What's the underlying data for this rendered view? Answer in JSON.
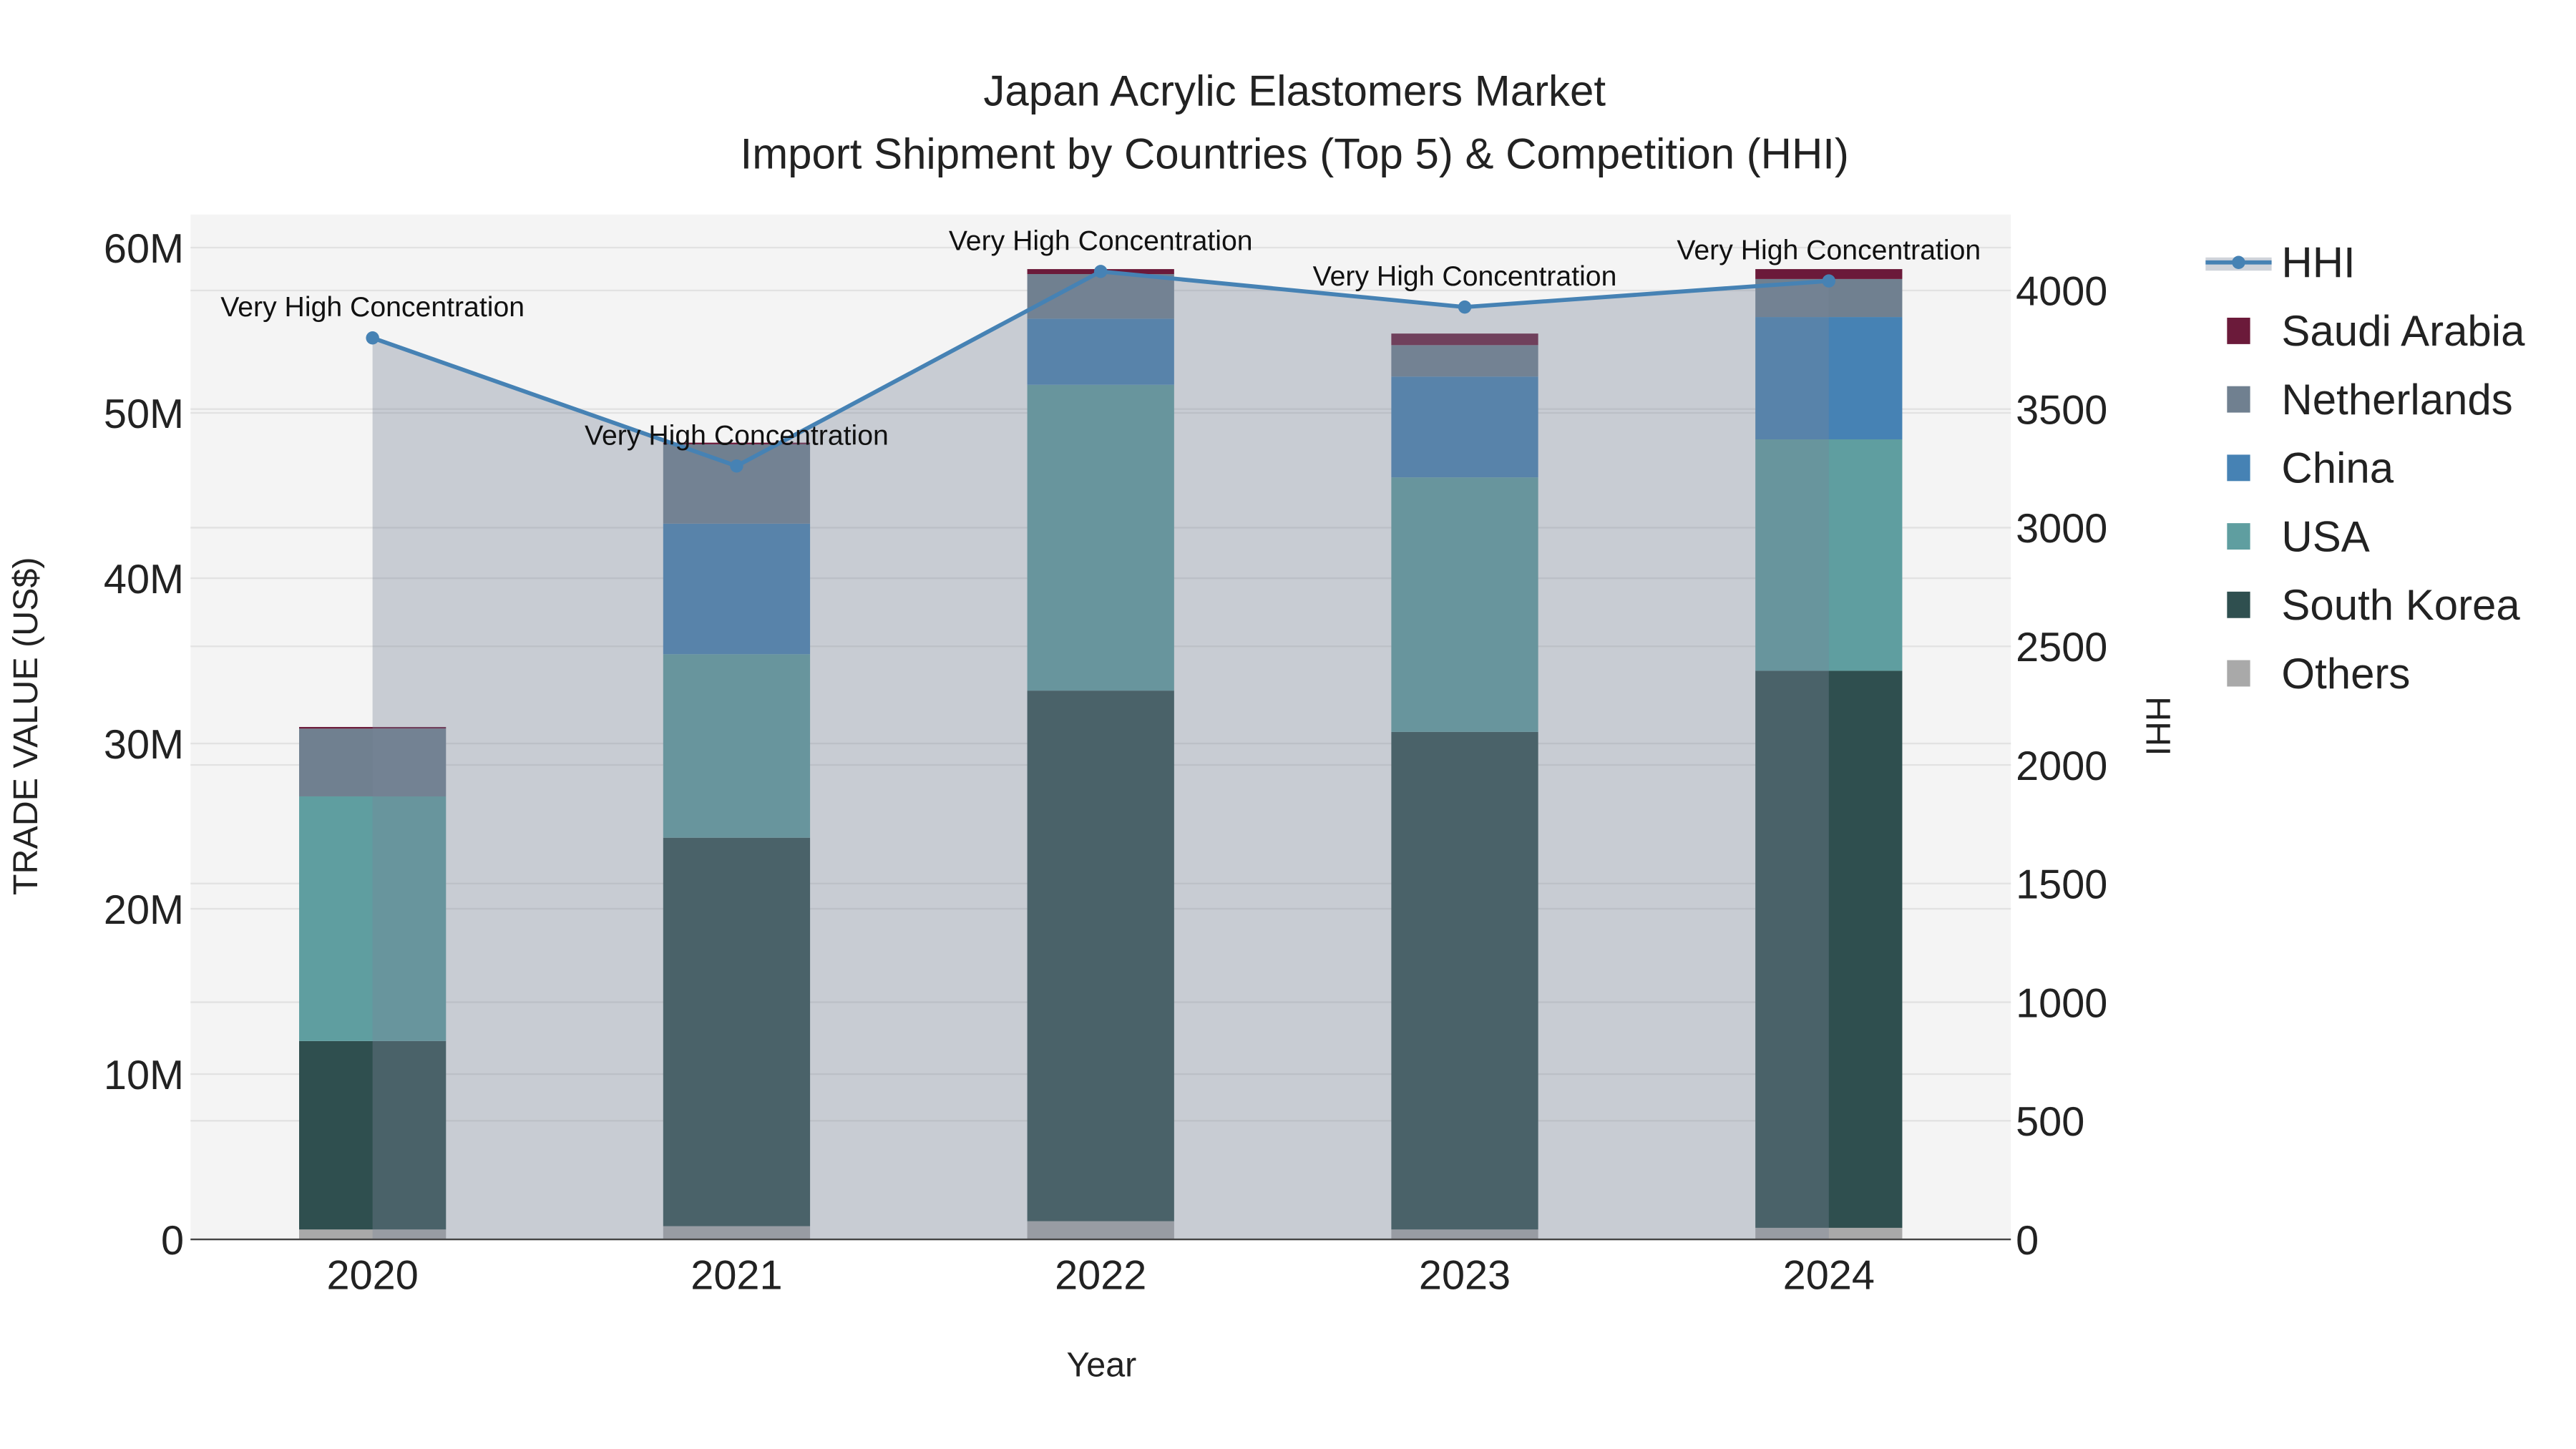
{
  "chart_data": {
    "type": "bar",
    "stacked": true,
    "title": "Japan Acrylic Elastomers Market",
    "subtitle": "Import Shipment by Countries (Top 5) & Competition (HHI)",
    "xlabel": "Year",
    "ylabel": "TRADE VALUE (US$)",
    "y2label": "HHI",
    "ylim": [
      0,
      62
    ],
    "y2lim": [
      0,
      4320
    ],
    "yticks": [
      {
        "v": 0,
        "label": "0"
      },
      {
        "v": 10,
        "label": "10M"
      },
      {
        "v": 20,
        "label": "20M"
      },
      {
        "v": 30,
        "label": "30M"
      },
      {
        "v": 40,
        "label": "40M"
      },
      {
        "v": 50,
        "label": "50M"
      },
      {
        "v": 60,
        "label": "60M"
      }
    ],
    "y2ticks": [
      {
        "v": 0,
        "label": "0"
      },
      {
        "v": 500,
        "label": "500"
      },
      {
        "v": 1000,
        "label": "1000"
      },
      {
        "v": 1500,
        "label": "1500"
      },
      {
        "v": 2000,
        "label": "2000"
      },
      {
        "v": 2500,
        "label": "2500"
      },
      {
        "v": 3000,
        "label": "3000"
      },
      {
        "v": 3500,
        "label": "3500"
      },
      {
        "v": 4000,
        "label": "4000"
      }
    ],
    "categories": [
      "2020",
      "2021",
      "2022",
      "2023",
      "2024"
    ],
    "value_unit": "million US$",
    "series": [
      {
        "name": "Others",
        "color": "#a9a9a9",
        "values": [
          0.6,
          0.8,
          1.1,
          0.6,
          0.7
        ]
      },
      {
        "name": "South Korea",
        "color": "#2f4f4f",
        "values": [
          11.4,
          23.5,
          32.1,
          30.1,
          33.7
        ]
      },
      {
        "name": "USA",
        "color": "#5f9ea0",
        "values": [
          14.8,
          11.1,
          18.5,
          15.4,
          14.0
        ]
      },
      {
        "name": "China",
        "color": "#4682b4",
        "values": [
          0.0,
          7.9,
          4.0,
          6.1,
          7.4
        ]
      },
      {
        "name": "Netherlands",
        "color": "#708090",
        "values": [
          4.1,
          4.8,
          2.7,
          1.9,
          2.3
        ]
      },
      {
        "name": "Saudi Arabia",
        "color": "#6b1a3a",
        "values": [
          0.1,
          0.1,
          0.3,
          0.7,
          0.6
        ]
      }
    ],
    "hhi": {
      "name": "HHI",
      "color": "#4682b4",
      "values": [
        3800,
        3260,
        4080,
        3930,
        4040
      ]
    },
    "annotations": [
      "Very High Concentration",
      "Very High Concentration",
      "Very High Concentration",
      "Very High Concentration",
      "Very High Concentration"
    ],
    "legend": [
      "HHI",
      "Saudi Arabia",
      "Netherlands",
      "China",
      "USA",
      "South Korea",
      "Others"
    ],
    "legend_position": "right",
    "grid": true
  }
}
